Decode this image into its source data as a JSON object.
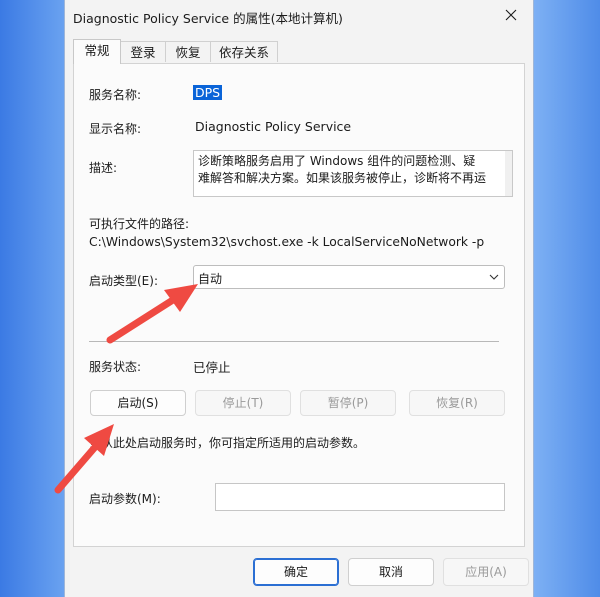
{
  "window": {
    "title": "Diagnostic Policy Service 的属性(本地计算机)"
  },
  "tabs": [
    {
      "label": "常规",
      "active": true
    },
    {
      "label": "登录",
      "active": false
    },
    {
      "label": "恢复",
      "active": false
    },
    {
      "label": "依存关系",
      "active": false
    }
  ],
  "general": {
    "service_name_label": "服务名称:",
    "service_name_value": "DPS",
    "display_name_label": "显示名称:",
    "display_name_value": "Diagnostic Policy Service",
    "description_label": "描述:",
    "description_line1": "诊断策略服务启用了 Windows 组件的问题检测、疑",
    "description_line2": "难解答和解决方案。如果该服务被停止，诊断将不再运",
    "path_label": "可执行文件的路径:",
    "path_value": "C:\\Windows\\System32\\svchost.exe -k LocalServiceNoNetwork -p",
    "startup_type_label": "启动类型(E):",
    "startup_type_value": "自动",
    "service_status_label": "服务状态:",
    "service_status_value": "已停止",
    "hint_text": "当从此处启动服务时，你可指定所适用的启动参数。",
    "params_label": "启动参数(M):",
    "params_value": ""
  },
  "service_buttons": {
    "start": "启动(S)",
    "stop": "停止(T)",
    "pause": "暂停(P)",
    "resume": "恢复(R)"
  },
  "dialog_buttons": {
    "ok": "确定",
    "cancel": "取消",
    "apply": "应用(A)"
  },
  "colors": {
    "accent": "#0a64d8",
    "arrow": "#ef4a42",
    "desktop": "#4a88e8"
  }
}
